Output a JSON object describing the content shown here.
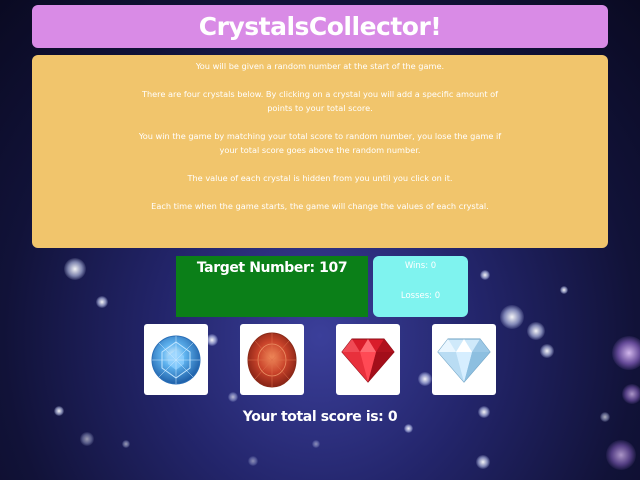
{
  "header": {
    "title": "CrystalsCollector!"
  },
  "instructions": {
    "paragraphs": [
      "You will be given a random number at the start of the game.",
      "There are four crystals below. By clicking on a crystal you will add a specific amount of points to your total score.",
      "You win the game by matching your total score to random number, you lose the game if your total score goes above the random number.",
      "The value of each crystal is hidden from you until you click on it.",
      "Each time when the game starts, the game will change the values of each crystal."
    ]
  },
  "target": {
    "text": "Target Number: 107"
  },
  "scoreboard": {
    "wins_text": "Wins: 0",
    "losses_text": "Losses: 0"
  },
  "crystals": [
    {
      "icon": "blue-round-crystal-icon",
      "color": "#3f9be0"
    },
    {
      "icon": "orange-oval-crystal-icon",
      "color": "#c9432a"
    },
    {
      "icon": "red-diamond-crystal-icon",
      "color": "#e3232f"
    },
    {
      "icon": "clear-diamond-crystal-icon",
      "color": "#a8d4f0"
    }
  ],
  "total_score": {
    "text": "Your total score is: 0"
  },
  "colors": {
    "title_bar": "#d98be6",
    "instructions_bg": "#f1c56c",
    "target_bg": "#0b7f18",
    "score_bg": "#7ff3ef"
  }
}
